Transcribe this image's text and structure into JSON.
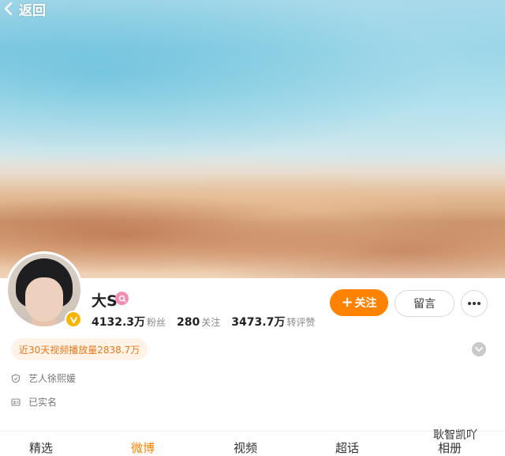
{
  "nav": {
    "back_label": "返回"
  },
  "profile": {
    "name": "大S",
    "stats": [
      {
        "value": "4132.3万",
        "label": "粉丝"
      },
      {
        "value": "280",
        "label": "关注"
      },
      {
        "value": "3473.7万",
        "label": "转评赞"
      }
    ],
    "follow_label": "关注",
    "message_label": "留言",
    "play_count_text": "近30天视频播放量2838.7万",
    "info": [
      {
        "icon": "shield-icon",
        "text": "艺人徐熙媛"
      },
      {
        "icon": "id-card-icon",
        "text": "已实名"
      }
    ]
  },
  "tabs": [
    {
      "label": "精选",
      "active": false
    },
    {
      "label": "微博",
      "active": true
    },
    {
      "label": "视频",
      "active": false
    },
    {
      "label": "超话",
      "active": false
    },
    {
      "label": "相册",
      "active": false
    }
  ],
  "watermark": "耿智凯吖",
  "colors": {
    "accent": "#ff8200",
    "verified": "#f7b500",
    "badge_pink": "#f28fb2"
  }
}
